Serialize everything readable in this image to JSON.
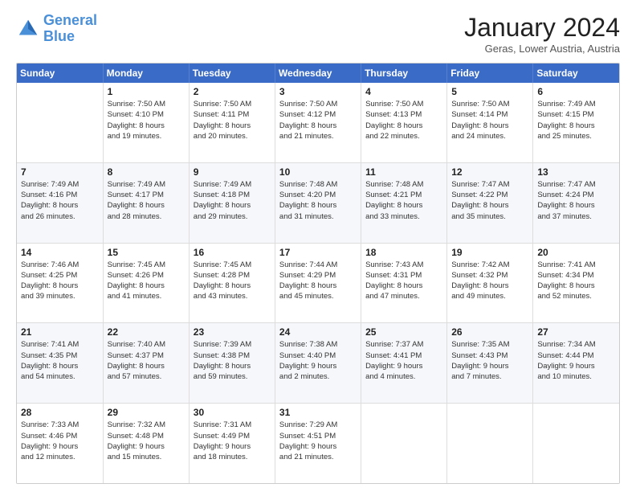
{
  "logo": {
    "line1": "General",
    "line2": "Blue"
  },
  "title": "January 2024",
  "location": "Geras, Lower Austria, Austria",
  "headers": [
    "Sunday",
    "Monday",
    "Tuesday",
    "Wednesday",
    "Thursday",
    "Friday",
    "Saturday"
  ],
  "weeks": [
    [
      {
        "day": "",
        "info": ""
      },
      {
        "day": "1",
        "info": "Sunrise: 7:50 AM\nSunset: 4:10 PM\nDaylight: 8 hours\nand 19 minutes."
      },
      {
        "day": "2",
        "info": "Sunrise: 7:50 AM\nSunset: 4:11 PM\nDaylight: 8 hours\nand 20 minutes."
      },
      {
        "day": "3",
        "info": "Sunrise: 7:50 AM\nSunset: 4:12 PM\nDaylight: 8 hours\nand 21 minutes."
      },
      {
        "day": "4",
        "info": "Sunrise: 7:50 AM\nSunset: 4:13 PM\nDaylight: 8 hours\nand 22 minutes."
      },
      {
        "day": "5",
        "info": "Sunrise: 7:50 AM\nSunset: 4:14 PM\nDaylight: 8 hours\nand 24 minutes."
      },
      {
        "day": "6",
        "info": "Sunrise: 7:49 AM\nSunset: 4:15 PM\nDaylight: 8 hours\nand 25 minutes."
      }
    ],
    [
      {
        "day": "7",
        "info": "Sunrise: 7:49 AM\nSunset: 4:16 PM\nDaylight: 8 hours\nand 26 minutes."
      },
      {
        "day": "8",
        "info": "Sunrise: 7:49 AM\nSunset: 4:17 PM\nDaylight: 8 hours\nand 28 minutes."
      },
      {
        "day": "9",
        "info": "Sunrise: 7:49 AM\nSunset: 4:18 PM\nDaylight: 8 hours\nand 29 minutes."
      },
      {
        "day": "10",
        "info": "Sunrise: 7:48 AM\nSunset: 4:20 PM\nDaylight: 8 hours\nand 31 minutes."
      },
      {
        "day": "11",
        "info": "Sunrise: 7:48 AM\nSunset: 4:21 PM\nDaylight: 8 hours\nand 33 minutes."
      },
      {
        "day": "12",
        "info": "Sunrise: 7:47 AM\nSunset: 4:22 PM\nDaylight: 8 hours\nand 35 minutes."
      },
      {
        "day": "13",
        "info": "Sunrise: 7:47 AM\nSunset: 4:24 PM\nDaylight: 8 hours\nand 37 minutes."
      }
    ],
    [
      {
        "day": "14",
        "info": "Sunrise: 7:46 AM\nSunset: 4:25 PM\nDaylight: 8 hours\nand 39 minutes."
      },
      {
        "day": "15",
        "info": "Sunrise: 7:45 AM\nSunset: 4:26 PM\nDaylight: 8 hours\nand 41 minutes."
      },
      {
        "day": "16",
        "info": "Sunrise: 7:45 AM\nSunset: 4:28 PM\nDaylight: 8 hours\nand 43 minutes."
      },
      {
        "day": "17",
        "info": "Sunrise: 7:44 AM\nSunset: 4:29 PM\nDaylight: 8 hours\nand 45 minutes."
      },
      {
        "day": "18",
        "info": "Sunrise: 7:43 AM\nSunset: 4:31 PM\nDaylight: 8 hours\nand 47 minutes."
      },
      {
        "day": "19",
        "info": "Sunrise: 7:42 AM\nSunset: 4:32 PM\nDaylight: 8 hours\nand 49 minutes."
      },
      {
        "day": "20",
        "info": "Sunrise: 7:41 AM\nSunset: 4:34 PM\nDaylight: 8 hours\nand 52 minutes."
      }
    ],
    [
      {
        "day": "21",
        "info": "Sunrise: 7:41 AM\nSunset: 4:35 PM\nDaylight: 8 hours\nand 54 minutes."
      },
      {
        "day": "22",
        "info": "Sunrise: 7:40 AM\nSunset: 4:37 PM\nDaylight: 8 hours\nand 57 minutes."
      },
      {
        "day": "23",
        "info": "Sunrise: 7:39 AM\nSunset: 4:38 PM\nDaylight: 8 hours\nand 59 minutes."
      },
      {
        "day": "24",
        "info": "Sunrise: 7:38 AM\nSunset: 4:40 PM\nDaylight: 9 hours\nand 2 minutes."
      },
      {
        "day": "25",
        "info": "Sunrise: 7:37 AM\nSunset: 4:41 PM\nDaylight: 9 hours\nand 4 minutes."
      },
      {
        "day": "26",
        "info": "Sunrise: 7:35 AM\nSunset: 4:43 PM\nDaylight: 9 hours\nand 7 minutes."
      },
      {
        "day": "27",
        "info": "Sunrise: 7:34 AM\nSunset: 4:44 PM\nDaylight: 9 hours\nand 10 minutes."
      }
    ],
    [
      {
        "day": "28",
        "info": "Sunrise: 7:33 AM\nSunset: 4:46 PM\nDaylight: 9 hours\nand 12 minutes."
      },
      {
        "day": "29",
        "info": "Sunrise: 7:32 AM\nSunset: 4:48 PM\nDaylight: 9 hours\nand 15 minutes."
      },
      {
        "day": "30",
        "info": "Sunrise: 7:31 AM\nSunset: 4:49 PM\nDaylight: 9 hours\nand 18 minutes."
      },
      {
        "day": "31",
        "info": "Sunrise: 7:29 AM\nSunset: 4:51 PM\nDaylight: 9 hours\nand 21 minutes."
      },
      {
        "day": "",
        "info": ""
      },
      {
        "day": "",
        "info": ""
      },
      {
        "day": "",
        "info": ""
      }
    ]
  ]
}
